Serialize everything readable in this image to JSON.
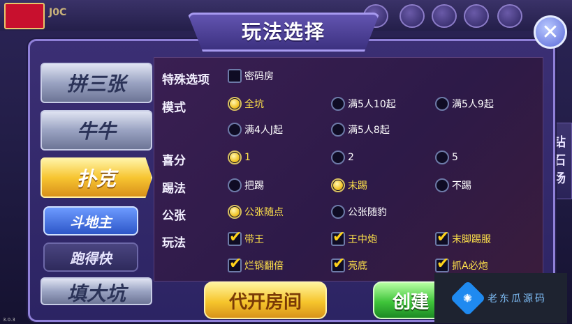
{
  "window": {
    "title": "玩法选择",
    "version": "3.0.3"
  },
  "top_bar": {
    "label": "J0C"
  },
  "side_right": {
    "label_chars": [
      "钻",
      "石",
      "场"
    ]
  },
  "tabs": [
    {
      "label": "拼三张"
    },
    {
      "label": "牛牛"
    },
    {
      "label": "扑克"
    },
    {
      "label": "填大坑"
    }
  ],
  "subtabs": [
    {
      "label": "斗地主"
    },
    {
      "label": "跑得快"
    }
  ],
  "options": {
    "special": {
      "label": "特殊选项",
      "items": [
        {
          "label": "密码房",
          "checked": false
        }
      ]
    },
    "mode": {
      "label": "模式",
      "items": [
        {
          "label": "全坑",
          "selected": true
        },
        {
          "label": "满5人10起",
          "selected": false
        },
        {
          "label": "满5人9起",
          "selected": false
        },
        {
          "label": "满4人J起",
          "selected": false
        },
        {
          "label": "满5人8起",
          "selected": false
        }
      ]
    },
    "bonus": {
      "label": "喜分",
      "items": [
        {
          "label": "1",
          "selected": true
        },
        {
          "label": "2",
          "selected": false
        },
        {
          "label": "5",
          "selected": false
        }
      ]
    },
    "kick": {
      "label": "踢法",
      "items": [
        {
          "label": "把踢",
          "selected": false
        },
        {
          "label": "末踢",
          "selected": true
        },
        {
          "label": "不踢",
          "selected": false
        }
      ]
    },
    "public": {
      "label": "公张",
      "items": [
        {
          "label": "公张随点",
          "selected": true
        },
        {
          "label": "公张随豹",
          "selected": false
        }
      ]
    },
    "rules": {
      "label": "玩法",
      "items": [
        {
          "label": "带王",
          "checked": true
        },
        {
          "label": "王中炮",
          "checked": true
        },
        {
          "label": "末脚踢服",
          "checked": true
        },
        {
          "label": "烂锅翻倍",
          "checked": true
        },
        {
          "label": "亮底",
          "checked": true
        },
        {
          "label": "抓A必炮",
          "checked": true
        }
      ]
    }
  },
  "buttons": {
    "open_room": "代开房间",
    "create": "创建"
  },
  "watermark": {
    "text": "老东瓜源码"
  }
}
